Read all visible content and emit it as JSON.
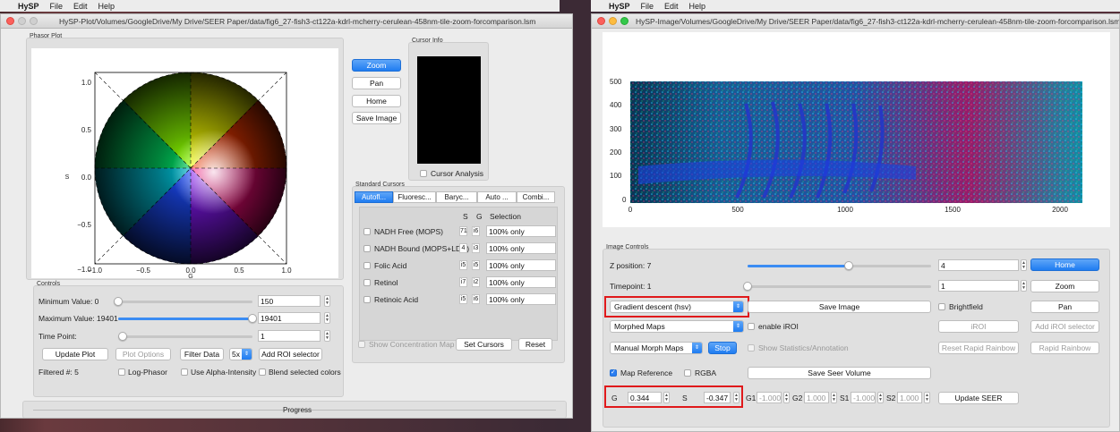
{
  "menubar_left": {
    "app": "HySP",
    "items": [
      "File",
      "Edit",
      "Help"
    ]
  },
  "menubar_right": {
    "app": "HySP",
    "items": [
      "File",
      "Edit",
      "Help"
    ]
  },
  "left_window": {
    "title": "HySP-Plot/Volumes/GoogleDrive/My Drive/SEER Paper/data/fig6_27-fish3-ct122a-kdrl-mcherry-cerulean-458nm-tile-zoom-forcomparison.lsm",
    "phasor_label": "Phasor Plot",
    "plot": {
      "ylabel": "S",
      "xlabel": "G",
      "yticks": [
        "1.0",
        "0.5",
        "0.0",
        "−0.5",
        "−1.0"
      ],
      "xticks": [
        "−1.0",
        "−0.5",
        "0.0",
        "0.5",
        "1.0"
      ]
    },
    "nav": {
      "zoom": "Zoom",
      "pan": "Pan",
      "home": "Home",
      "save": "Save Image"
    },
    "cursor_info_label": "Cursor Info",
    "cursor_analysis": "Cursor Analysis",
    "std_cursors_label": "Standard Cursors",
    "tabs": [
      "Autofl...",
      "Fluoresc...",
      "Baryc...",
      "Auto ...",
      "Combi..."
    ],
    "table_headers": {
      "s": "S",
      "g": "G",
      "sel": "Selection"
    },
    "cursor_rows": [
      {
        "name": "NADH Free (MOPS)",
        "s": "71",
        "g": "i6",
        "sel": "100% only"
      },
      {
        "name": "NADH Bound (MOPS+LDH)",
        "s": "4",
        "g": "i3",
        "sel": "100% only"
      },
      {
        "name": "Folic Acid",
        "s": "i5",
        "g": "i5",
        "sel": "100% only"
      },
      {
        "name": "Retinol",
        "s": "i7",
        "g": "i2",
        "sel": "100% only"
      },
      {
        "name": "Retinoic Acid",
        "s": "i5",
        "g": "i6",
        "sel": "100% only"
      }
    ],
    "show_conc_map": "Show Concentration Map",
    "set_cursors": "Set Cursors",
    "reset": "Reset",
    "controls_label": "Controls",
    "min_label": "Minimum Value: 0",
    "min_value": "150",
    "max_label": "Maximum Value: 19401",
    "max_value": "19401",
    "max_level": 1.0,
    "min_level": 0.0,
    "time_label": "Time Point:",
    "time_value": "1",
    "update_plot": "Update Plot",
    "plot_options": "Plot Options",
    "filter_data": "Filter Data",
    "filter_x": "5x",
    "add_roi": "Add ROI selector",
    "filtered": "Filtered #: 5",
    "log_phasor": "Log-Phasor",
    "alpha_intensity": "Use Alpha-Intensity",
    "blend": "Blend selected colors",
    "progress": "Progress"
  },
  "right_window": {
    "title": "HySP-Image/Volumes/GoogleDrive/My Drive/SEER Paper/data/fig6_27-fish3-ct122a-kdrl-mcherry-cerulean-458nm-tile-zoom-forcomparison.lsm",
    "image": {
      "yticks": [
        "500",
        "400",
        "300",
        "200",
        "100",
        "0"
      ],
      "xticks": [
        "0",
        "500",
        "1000",
        "1500",
        "2000"
      ]
    },
    "controls_label": "Image Controls",
    "zpos_label": "Z position: 7",
    "zpos_value": "4",
    "zpos_level": 0.55,
    "timepoint_label": "Timepoint: 1",
    "timepoint_value": "1",
    "timepoint_level": 0.0,
    "home": "Home",
    "zoom": "Zoom",
    "pan": "Pan",
    "map_select": "Gradient descent (hsv)",
    "save_image": "Save Image",
    "brightfield": "Brightfield",
    "morphed_select": "Morphed Maps",
    "enable_iroi": "enable iROI",
    "iroi": "iROI",
    "add_iroi": "Add iROI selector",
    "manual_select": "Manual Morph Maps",
    "stop": "Stop",
    "show_stats": "Show Statistics/Annotation",
    "reset_rainbow": "Reset Rapid Rainbow",
    "rapid_rainbow": "Rapid Rainbow",
    "map_reference": "Map Reference",
    "rgba": "RGBA",
    "save_seer": "Save Seer Volume",
    "g_label": "G",
    "g_value": "0.344",
    "s_label": "S",
    "s_value": "-0.347",
    "g1_label": "G1",
    "g1_value": "-1.000",
    "g2_label": "G2",
    "g2_value": "1.000",
    "s1_label": "S1",
    "s1_value": "-1.000",
    "s2_label": "S2",
    "s2_value": "1.000",
    "update_seer": "Update SEER"
  }
}
